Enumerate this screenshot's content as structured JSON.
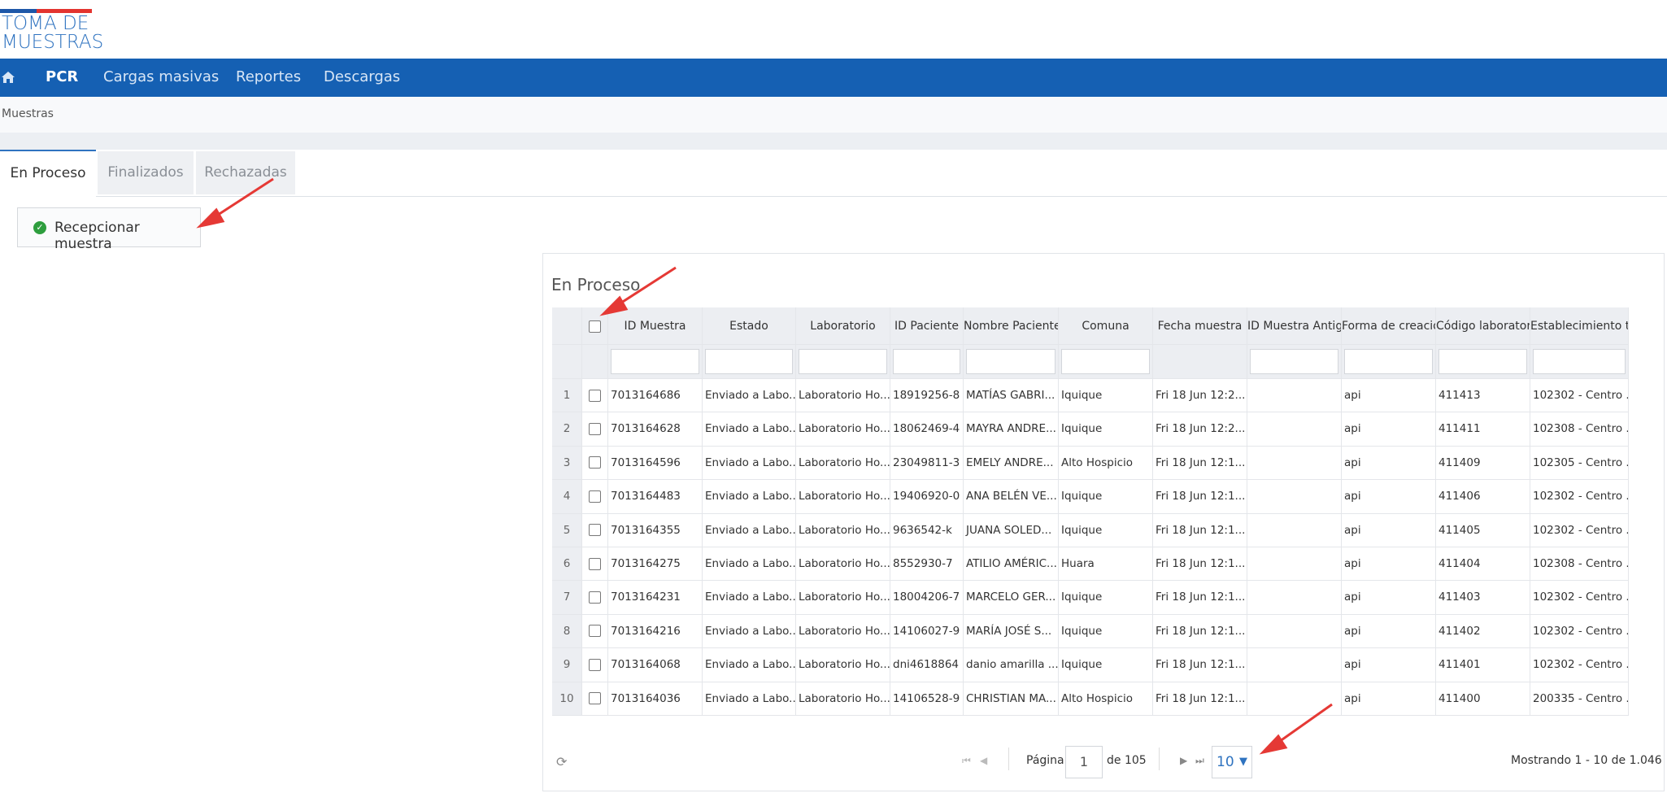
{
  "app": {
    "logo_text": "TOMA DE\nMUESTRAS"
  },
  "nav": {
    "home_icon": "home-icon",
    "items": [
      "PCR",
      "Cargas masivas",
      "Reportes",
      "Descargas"
    ]
  },
  "breadcrumb": "Muestras",
  "tabs": [
    "En Proceso",
    "Finalizados",
    "Rechazadas"
  ],
  "actions": {
    "receive_label": "Recepcionar muestra",
    "receive_icon": "check-circle-icon"
  },
  "panel": {
    "title": "En Proceso"
  },
  "grid": {
    "columns": [
      "ID Muestra",
      "Estado",
      "Laboratorio",
      "ID Paciente",
      "Nombre Paciente",
      "Comuna",
      "Fecha muestra",
      "ID Muestra Antig",
      "Forma de creacio",
      "Código laborator",
      "Establecimiento t"
    ],
    "rows": [
      [
        "1",
        "7013164686",
        "Enviado a Labo...",
        "Laboratorio Ho...",
        "18919256-8",
        "MATÍAS GABRI...",
        "Iquique",
        "Fri 18 Jun 12:2...",
        "",
        "api",
        "411413",
        "102302 - Centro ..."
      ],
      [
        "2",
        "7013164628",
        "Enviado a Labo...",
        "Laboratorio Ho...",
        "18062469-4",
        "MAYRA ANDRE...",
        "Iquique",
        "Fri 18 Jun 12:2...",
        "",
        "api",
        "411411",
        "102308 - Centro ..."
      ],
      [
        "3",
        "7013164596",
        "Enviado a Labo...",
        "Laboratorio Ho...",
        "23049811-3",
        "EMELY ANDRE...",
        "Alto Hospicio",
        "Fri 18 Jun 12:1...",
        "",
        "api",
        "411409",
        "102305 - Centro ..."
      ],
      [
        "4",
        "7013164483",
        "Enviado a Labo...",
        "Laboratorio Ho...",
        "19406920-0",
        "ANA BELÉN VE...",
        "Iquique",
        "Fri 18 Jun 12:1...",
        "",
        "api",
        "411406",
        "102302 - Centro ..."
      ],
      [
        "5",
        "7013164355",
        "Enviado a Labo...",
        "Laboratorio Ho...",
        "9636542-k",
        "JUANA SOLED...",
        "Iquique",
        "Fri 18 Jun 12:1...",
        "",
        "api",
        "411405",
        "102302 - Centro ..."
      ],
      [
        "6",
        "7013164275",
        "Enviado a Labo...",
        "Laboratorio Ho...",
        "8552930-7",
        "ATILIO AMÉRIC...",
        "Huara",
        "Fri 18 Jun 12:1...",
        "",
        "api",
        "411404",
        "102308 - Centro ..."
      ],
      [
        "7",
        "7013164231",
        "Enviado a Labo...",
        "Laboratorio Ho...",
        "18004206-7",
        "MARCELO GER...",
        "Iquique",
        "Fri 18 Jun 12:1...",
        "",
        "api",
        "411403",
        "102302 - Centro ..."
      ],
      [
        "8",
        "7013164216",
        "Enviado a Labo...",
        "Laboratorio Ho...",
        "14106027-9",
        "MARÍA JOSÉ S...",
        "Iquique",
        "Fri 18 Jun 12:1...",
        "",
        "api",
        "411402",
        "102302 - Centro ..."
      ],
      [
        "9",
        "7013164068",
        "Enviado a Labo...",
        "Laboratorio Ho...",
        "dni4618864",
        "danio amarilla ...",
        "Iquique",
        "Fri 18 Jun 12:1...",
        "",
        "api",
        "411401",
        "102302 - Centro ..."
      ],
      [
        "10",
        "7013164036",
        "Enviado a Labo...",
        "Laboratorio Ho...",
        "14106528-9",
        "CHRISTIAN MA...",
        "Alto Hospicio",
        "Fri 18 Jun 12:1...",
        "",
        "api",
        "411400",
        "200335 - Centro ..."
      ]
    ]
  },
  "pager": {
    "page_label": "Página",
    "page_value": "1",
    "of_label": "de 105",
    "page_size": "10",
    "info": "Mostrando 1 - 10 de 1.046",
    "refresh_icon": "refresh-icon"
  },
  "annotations": {
    "arrow_color": "#e53935"
  }
}
